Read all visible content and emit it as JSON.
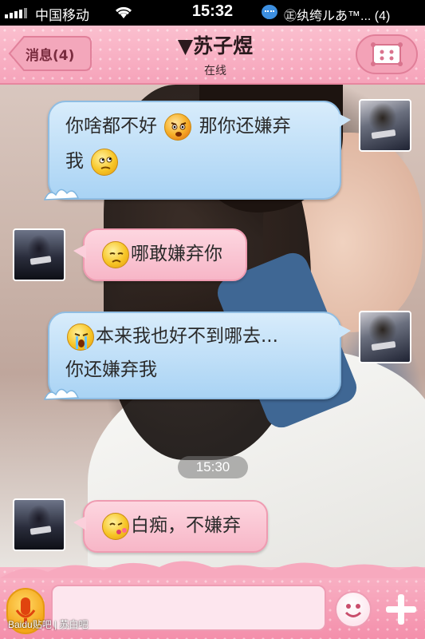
{
  "status_bar": {
    "carrier": "中国移动",
    "time": "15:32",
    "notification": "㊣纨绔ルあ™... (4)",
    "icons": [
      "signal-icon",
      "wifi-icon",
      "chat-notification-icon"
    ]
  },
  "nav": {
    "back_label": "消息(4)",
    "contact_name": "▼苏子煜",
    "contact_status": "在线",
    "menu_icon": "menu-icon"
  },
  "messages": [
    {
      "side": "right",
      "style": "blue",
      "parts": [
        "你啥都不好",
        "[emoji:angry]",
        "那你还嫌弃",
        "我",
        "[emoji:thinking]"
      ],
      "line1": "你啥都不好",
      "mid1": "那你还嫌弃",
      "line2": "我"
    },
    {
      "side": "left",
      "style": "pink",
      "text": "哪敢嫌弃你",
      "emoji": "sad"
    },
    {
      "side": "right",
      "style": "blue",
      "line1": "本来我也好不到哪去...",
      "line2": "你还嫌弃我",
      "emoji": "crying"
    },
    {
      "side": "left",
      "style": "pink",
      "text": "白痴，不嫌弃",
      "emoji": "kiss"
    }
  ],
  "timestamp": "15:30",
  "input": {
    "value": "",
    "placeholder": ""
  },
  "bottom_icons": [
    "microphone-icon",
    "emoji-smile-icon",
    "plus-icon"
  ],
  "watermark": "Baidu贴吧 | 苏白吧",
  "colors": {
    "nav_pink": "#f6a3ba",
    "bubble_blue": "#a9d3f4",
    "bubble_pink": "#f7b6c7",
    "status_bar": "#000000"
  }
}
